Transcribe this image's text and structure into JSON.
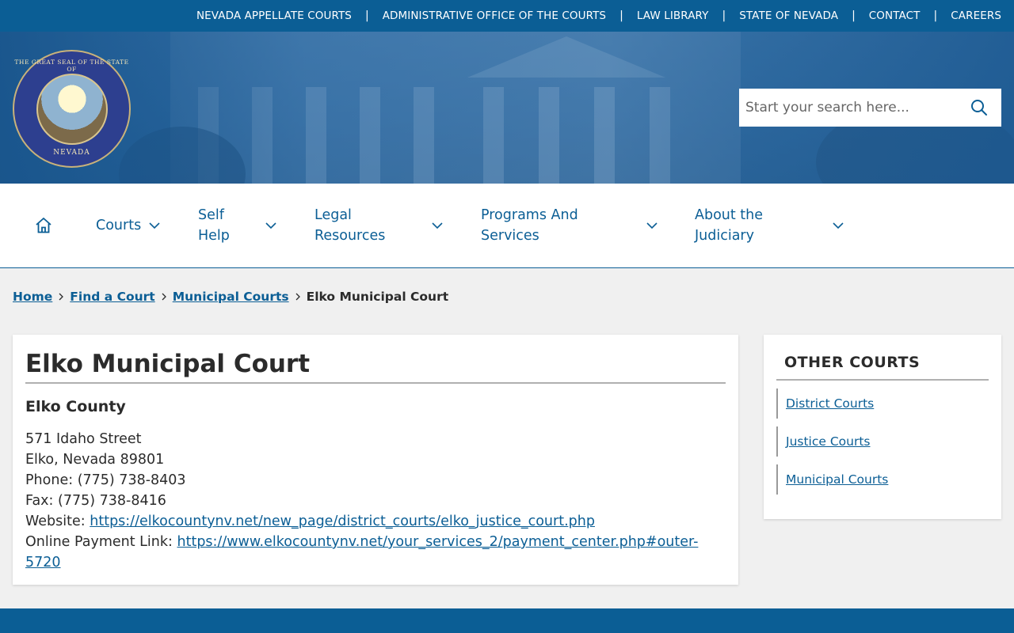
{
  "topbar": {
    "links": [
      "NEVADA APPELLATE COURTS",
      "ADMINISTRATIVE OFFICE OF THE COURTS",
      "LAW LIBRARY",
      "STATE OF NEVADA",
      "CONTACT",
      "CAREERS"
    ],
    "separator": "|"
  },
  "seal": {
    "top_text": "THE GREAT SEAL OF THE STATE OF",
    "motto": "ALL FOR OUR COUNTRY",
    "bottom_text": "NEVADA"
  },
  "search": {
    "placeholder": "Start your search here..."
  },
  "nav": {
    "items": [
      {
        "line1": "Courts",
        "line2": ""
      },
      {
        "line1": "Self",
        "line2": "Help"
      },
      {
        "line1": "Legal",
        "line2": "Resources"
      },
      {
        "line1": "Programs And",
        "line2": "Services"
      },
      {
        "line1": "About the",
        "line2": "Judiciary"
      }
    ]
  },
  "breadcrumb": {
    "links": [
      "Home",
      "Find a Court",
      "Municipal Courts"
    ],
    "current": "Elko Municipal Court"
  },
  "court": {
    "title": "Elko Municipal Court",
    "county": "Elko County",
    "street": "571 Idaho Street",
    "city": "Elko, Nevada 89801",
    "phone_label": "Phone:",
    "phone": "(775) 738-8403",
    "fax_label": "Fax:",
    "fax": "(775) 738-8416",
    "website_label": "Website:",
    "website": "https://elkocountynv.net/new_page/district_courts/elko_justice_court.php",
    "payment_label": "Online Payment Link:",
    "payment_line1": "https://www.elkocountynv.net/your_services_2/payment_center.php#outer-",
    "payment_line2": "5720"
  },
  "sidebar": {
    "title": "OTHER COURTS",
    "links": [
      "District Courts",
      "Justice Courts",
      "Municipal Courts"
    ]
  },
  "colors": {
    "brand_blue": "#0b5e95",
    "page_bg": "#f0f0f0",
    "text": "#2b2b2b"
  }
}
